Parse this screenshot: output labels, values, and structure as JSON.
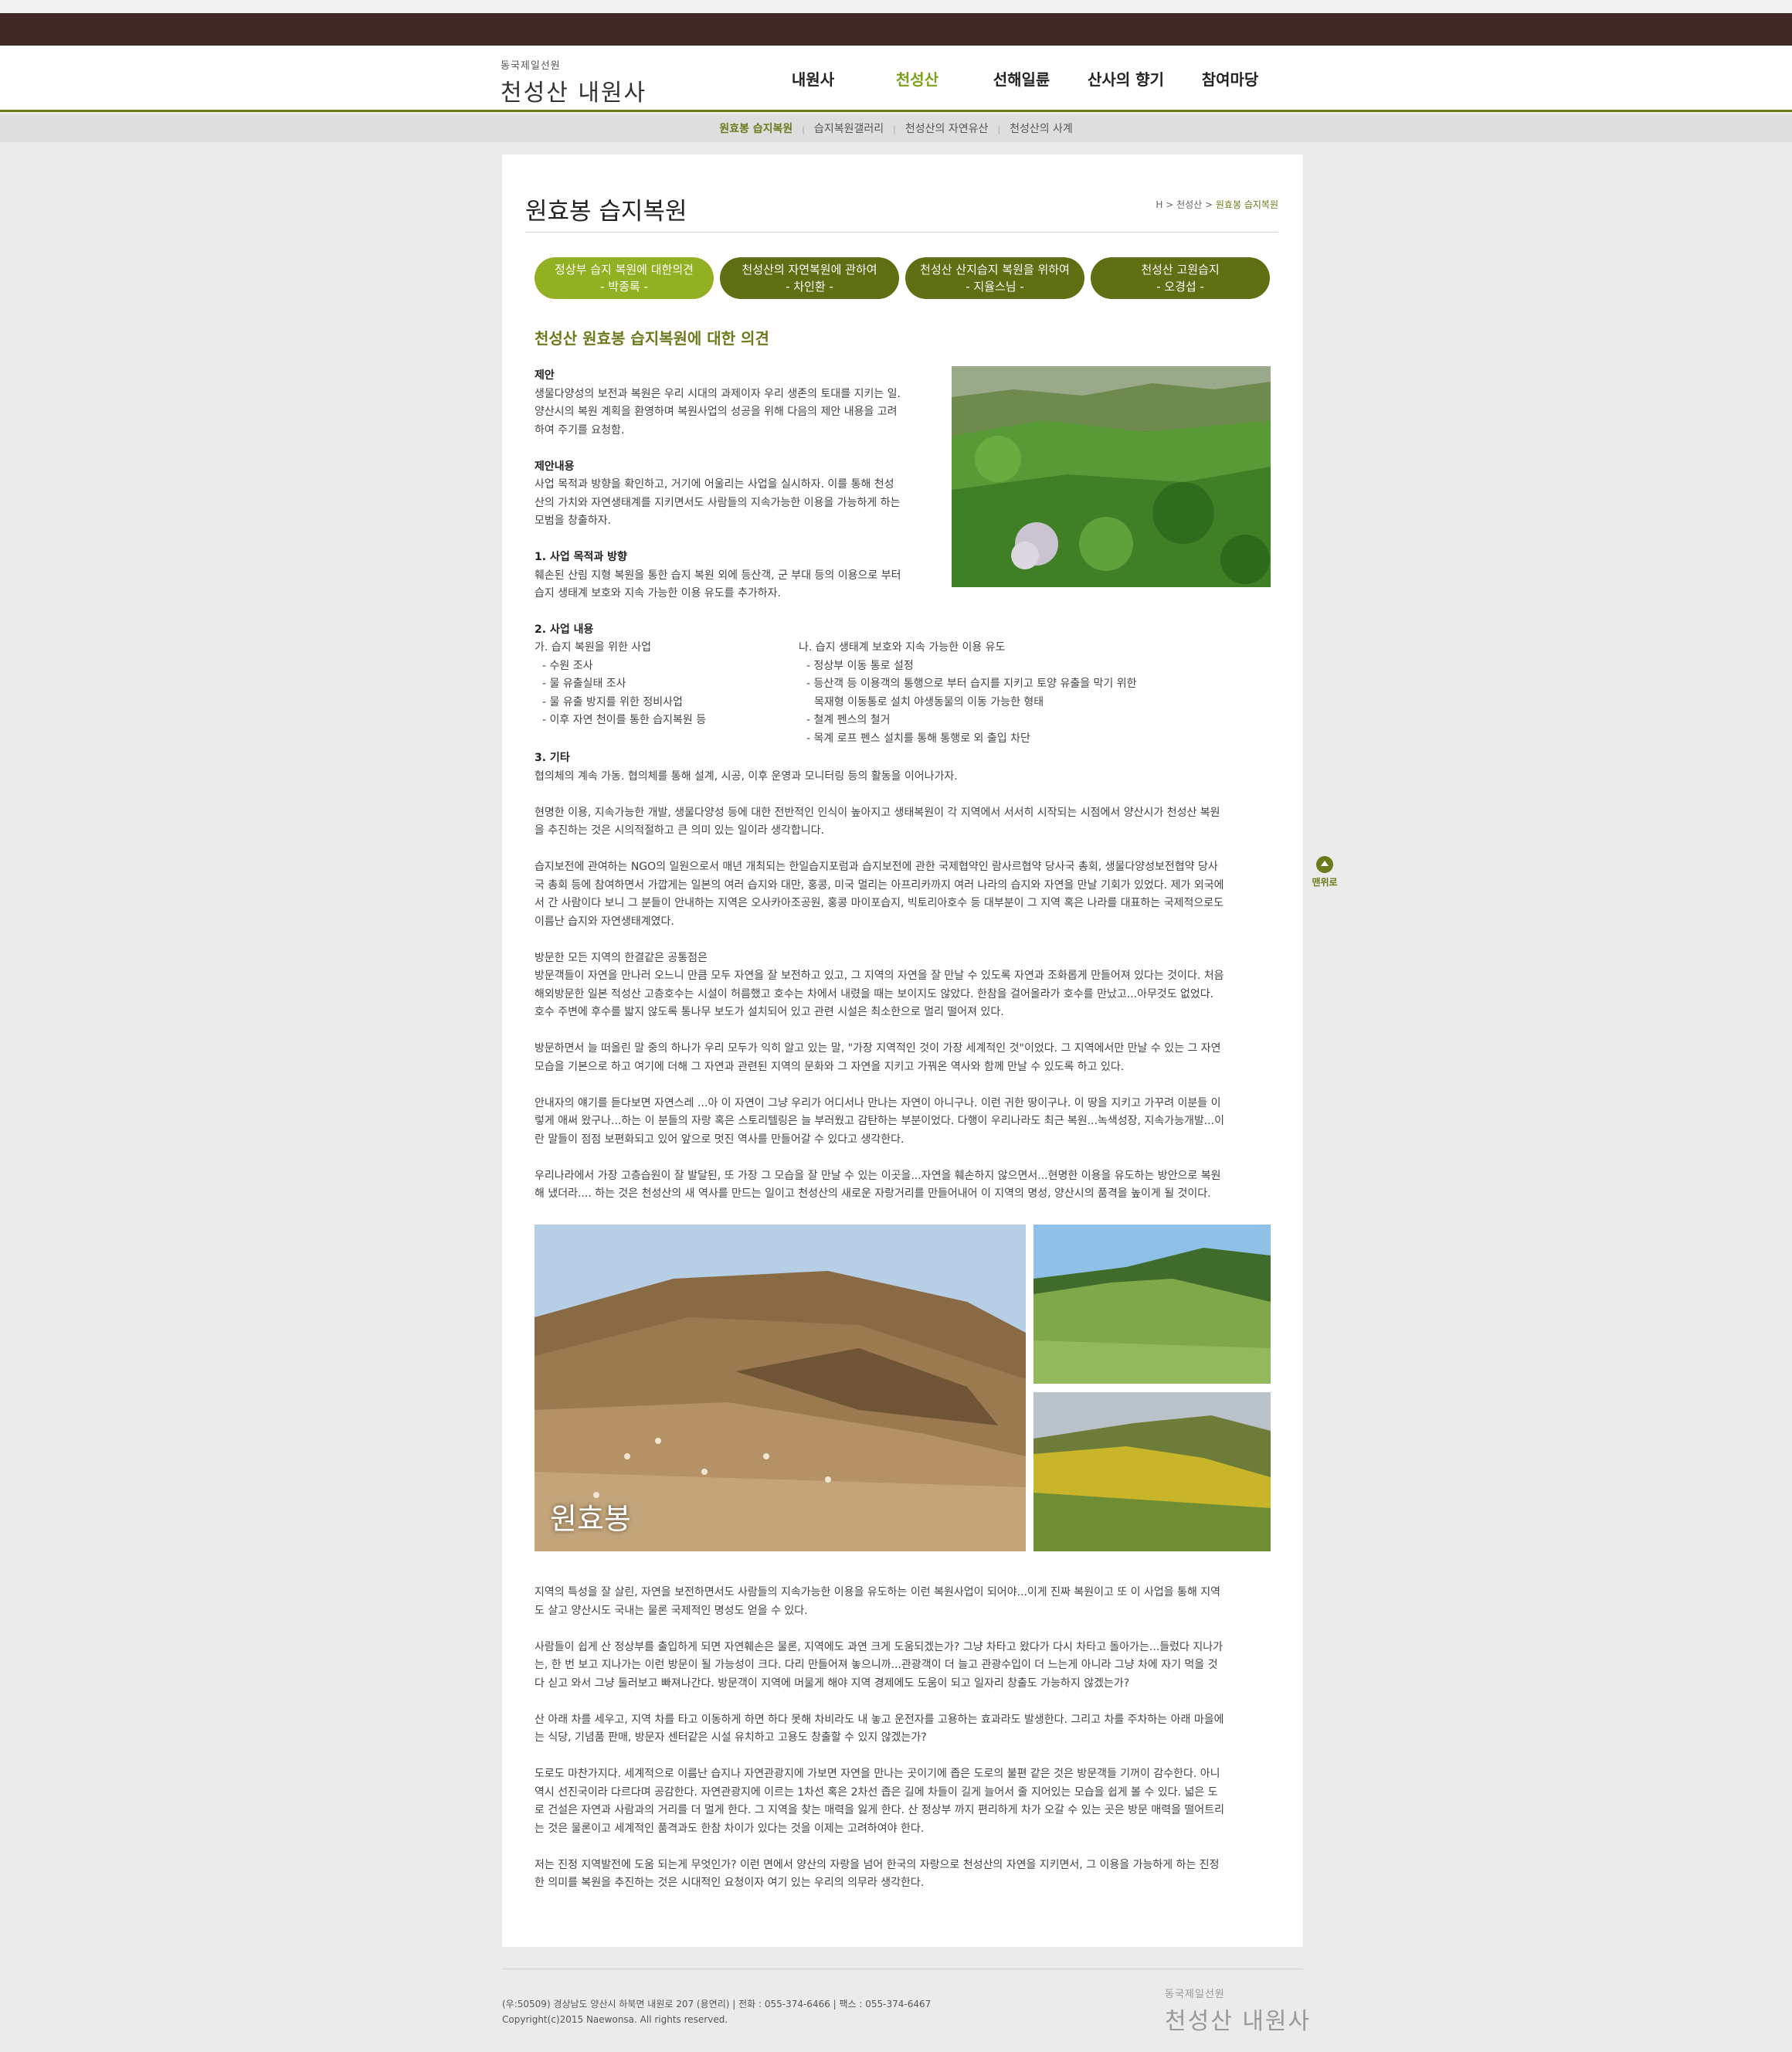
{
  "site": {
    "logo_sub": "동국제일선원",
    "logo_main": "천성산 내원사"
  },
  "gnb": [
    "내원사",
    "천성산",
    "선해일륜",
    "산사의 향기",
    "참여마당"
  ],
  "lnb": [
    "원효봉 습지복원",
    "습지복원갤러리",
    "천성산의 자연유산",
    "천성산의 사계"
  ],
  "page": {
    "title": "원효봉 습지복원",
    "breadcrumb_home": "H",
    "breadcrumb_mid": "천성산",
    "breadcrumb_current": "원효봉 습지복원"
  },
  "tabs": [
    {
      "line1": "정상부 습지 복원에 대한의견",
      "line2": "- 박종록 -"
    },
    {
      "line1": "천성산의 자연복원에 관하여",
      "line2": "- 차인환 -"
    },
    {
      "line1": "천성산 산지습지 복원을 위하여",
      "line2": "- 지율스님 -"
    },
    {
      "line1": "천성산 고원습지",
      "line2": "- 오경섭 -"
    }
  ],
  "article": {
    "title": "천성산 원효봉 습지복원에 대한 의견",
    "s1_head": "제안",
    "s1_l1": "생물다양성의 보전과 복원은 우리 시대의 과제이자 우리 생존의 토대를 지키는 일.",
    "s1_l2": "양산시의 복원 계획을 환영하며 복원사업의 성공을 위해 다음의 제안 내용을 고려",
    "s1_l3": "하여 주기를 요청함.",
    "s2_head": "제안내용",
    "s2_l1": "사업 목적과 방향을 확인하고, 거기에 어울리는 사업을 실시하자. 이를 통해 천성",
    "s2_l2": "산의 가치와 자연생태계를 지키면서도 사람들의 지속가능한 이용을 가능하게 하는",
    "s2_l3": "모범을 창출하자.",
    "s3_head": "1. 사업 목적과 방향",
    "s3_l1": "훼손된 산림 지형 복원을 통한 습지 복원 외에 등산객, 군 부대 등의 이용으로 부터",
    "s3_l2": "습지 생태계 보호와 지속 가능한 이용 유도를 추가하자.",
    "s4_head": "2. 사업 내용",
    "left_col": [
      "가. 습지 복원을 위한 사업",
      "- 수원 조사",
      "- 물 유출실태 조사",
      "- 물 유출 방지를 위한 정비사업",
      "- 이후 자연 천이를 통한 습지복원 등"
    ],
    "right_col": [
      "나. 습지 생태계 보호와 지속 가능한 이용 유도",
      "- 정상부 이동 통로 설정",
      "- 등산객 등 이용객의 통행으로 부터 습지를 지키고 토양 유출을 막기 위한",
      "목재형 이동통로 설치 야생동물의 이동 가능한 형태",
      "- 철계 펜스의 철거",
      "- 목계 로프 펜스 설치를 통해 통행로 외 출입 차단"
    ],
    "s5_head": "3. 기타",
    "s5_l1": "협의체의 계속 가동. 협의체를 통해 설계, 시공, 이후 운영과 모니터링 등의 활동을 이어나가자.",
    "p1": [
      "현명한 이용, 지속가능한 개발, 생물다양성 등에 대한 전반적인 인식이 높아지고 생태복원이 각 지역에서 서서히 시작되는 시점에서 양산시가 천성산 복원",
      "을 추진하는 것은 시의적절하고 큰 의미 있는 일이라 생각합니다."
    ],
    "p2": [
      "습지보전에 관여하는 NGO의 일원으로서 매년 개최되는 한일습지포럼과 습지보전에 관한 국제협약인 람사르협약 당사국 총회, 생물다양성보전협약 당사",
      "국 총회 등에 참여하면서 가깝게는 일본의 여러 습지와 대만, 홍콩, 미국 멀리는 아프리카까지 여러 나라의 습지와 자연을 만날 기회가 있었다. 제가 외국에",
      "서 간 사람이다 보니 그 분들이 안내하는 지역은 오사카아조공원, 홍콩 마이포습지, 빅토리아호수 등 대부분이 그 지역 혹은 나라를 대표하는 국제적으로도",
      "이름난 습지와 자연생태계였다."
    ],
    "p3": [
      "방문한 모든 지역의 한결같은 공통점은",
      "방문객들이 자연을 만나러 오느니 만큼 모두 자연을 잘 보전하고 있고, 그 지역의 자연을 잘 만날 수 있도록 자연과 조화롭게 만들어져 있다는 것이다. 처음",
      "해외방문한 일본 적성산 고층호수는 시설이 허름했고 호수는 차에서 내렸을 때는 보이지도 않았다. 한참을 걸어올라가 호수를 만났고...아무것도 없었다.",
      "호수 주변에 후수를 밟지 않도록 통나무 보도가 설치되어 있고 관련 시설은 최소한으로 멀리 떨어져 있다."
    ],
    "p4": [
      "방문하면서 늘 떠올린 말 중의 하나가 우리 모두가 익히 알고 있는 말, \"가장 지역적인 것이 가장 세계적인 것\"이었다. 그 지역에서만 만날 수 있는 그 자연",
      "모습을 기본으로 하고 여기에 더해 그 자연과 관련된 지역의 문화와 그 자연을 지키고 가꿔온 역사와 함께 만날 수 있도록 하고 있다."
    ],
    "p5": [
      "안내자의 얘기를 듣다보면 자연스레 ...아 이 자연이 그냥 우리가 어디서나 만나는 자연이 아니구나. 이런 귀한 땅이구나. 이 땅을 지키고 가꾸려 이분들 이",
      "렇게 애써 왔구나...하는 이 분들의 자랑 혹은 스토리텔링은 늘 부러웠고 감탄하는 부분이었다. 다행이 우리나라도 최근 복원...녹색성장, 지속가능개발...이",
      "란 말들이 점점 보편화되고 있어 앞으로 멋진 역사를 만들어갈 수 있다고 생각한다."
    ],
    "p6": [
      "우리나라에서 가장 고층습원이 잘 발달된, 또 가장 그 모습을 잘 만날 수 있는 이곳을...자연을 훼손하지 않으면서...현명한 이용을 유도하는 방안으로 복원",
      "해 냈더라.... 하는 것은 천성산의 새 역사를 만드는 일이고 천성산의 새로운 자랑거리를 만들어내어 이 지역의 명성, 양산시의 품격을 높이게 될 것이다."
    ],
    "photo_label": "원효봉",
    "p7": [
      "지역의 특성을 잘 살린, 자연을 보전하면서도 사람들의 지속가능한 이용을 유도하는 이런 복원사업이 되어야...이게 진짜 복원이고 또 이 사업을 통해 지역",
      "도 살고 양산시도 국내는 물론 국제적인 명성도 얻을 수 있다."
    ],
    "p8": [
      "사람들이 쉽게 산 정상부를 출입하게 되면 자연훼손은 물론, 지역에도 과연 크게 도움되겠는가? 그냥 차타고 왔다가 다시 차타고 돌아가는...들렀다 지나가",
      "는, 한 번 보고 지나가는 이런 방문이 될 가능성이 크다. 다리 만들어져 놓으니까...관광객이 더 늘고 관광수입이 더 느는게 아니라 그냥 차에 자기 먹을 것",
      "다 싣고 와서 그냥 둘러보고 빠져나간다. 방문객이 지역에 머물게 해야 지역 경제에도 도움이 되고 일자리 창출도 가능하지 않겠는가?"
    ],
    "p9": [
      "산 아래 차를 세우고, 지역 차를 타고 이동하게 하면 하다 못해 차비라도 내 놓고 운전자를 고용하는 효과라도 발생한다. 그리고 차를 주차하는 아래 마을에",
      "는 식당, 기념품 판매, 방문자 센터같은 시설 유치하고 고용도 창출할 수 있지 않겠는가?"
    ],
    "p10": [
      "도로도 마찬가지다. 세계적으로 이름난 습지나 자연관광지에 가보면 자연을 만나는 곳이기에 좁은 도로의 불편 같은 것은 방문객들 기꺼이 감수한다. 아니",
      "역시 선진국이라 다르다며 공감한다. 자연관광지에 이르는 1차선 혹은 2차선 좁은 길에 차들이 길게 늘어서 줄 지어있는 모습을 쉽게 볼 수 있다. 넓은 도",
      "로 건설은 자연과 사람과의 거리를 더 멀게 한다. 그 지역을 찾는 매력을 잃게 한다. 산 정상부 까지 편리하게 차가 오갈 수 있는 곳은 방문 매력을 떨어트리",
      "는 것은 물론이고 세계적인 품격과도 한참 차이가 있다는 것을 이제는 고려하여야 한다."
    ],
    "p11": [
      "저는 진정 지역발전에 도움 되는게 무엇인가? 이런 면에서 양산의 자랑을 넘어 한국의 자랑으로 천성산의 자연을 지키면서, 그 이용을 가능하게 하는 진정",
      "한 의미를 복원을 추진하는 것은 시대적인 요청이자 여기 있는 우리의 의무라 생각한다."
    ]
  },
  "totop": "맨위로",
  "footer": {
    "addr": "(우:50509) 경상남도 양산시 하북면 내원로 207 (용연리)   |   전화 : 055-374-6466   |   팩스 : 055-374-6467",
    "copyright": "Copyright(c)2015 Naewonsa. All rights reserved.",
    "logo_sub": "동국제일선원",
    "logo_main": "천성산 내원사"
  }
}
